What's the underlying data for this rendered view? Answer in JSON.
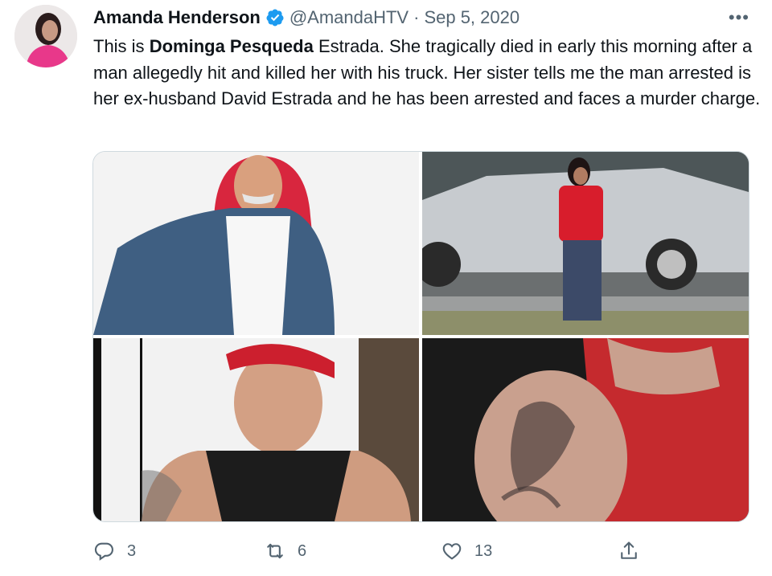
{
  "tweet": {
    "author_name": "Amanda Henderson",
    "handle": "@AmandaHTV",
    "separator": "·",
    "date": "Sep 5, 2020",
    "more": "•••",
    "text_parts": [
      "This is ",
      "Dominga Pesqueda",
      " Estrada. She tragically died in early this morning after a man allegedly hit and killed her with his truck. Her sister tells me the man arrested is her ex-husband David Estrada and he has been arrested and faces a murder charge."
    ]
  },
  "actions": {
    "reply_count": "3",
    "retweet_count": "6",
    "like_count": "13"
  },
  "icons": {
    "verified": "verified-badge-icon",
    "reply": "reply-icon",
    "retweet": "retweet-icon",
    "like": "heart-icon",
    "share": "share-icon",
    "more": "more-icon"
  },
  "colors": {
    "text": "#0f1419",
    "secondary": "#536471",
    "verified": "#1d9bf0",
    "border": "#cfd9de"
  }
}
